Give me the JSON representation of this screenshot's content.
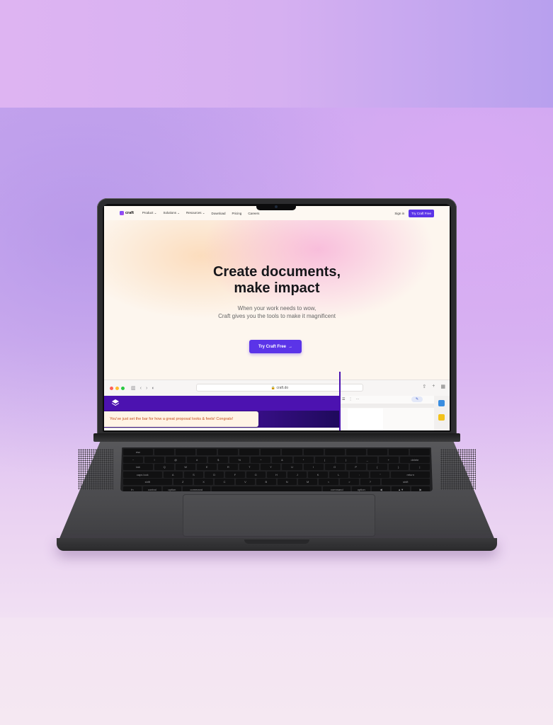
{
  "site": {
    "logo_text": "craft",
    "nav": [
      "Product ⌄",
      "Solutions ⌄",
      "Resources ⌄",
      "Download",
      "Pricing",
      "Careers"
    ],
    "sign_in": "Sign in",
    "nav_cta": "Try Craft Free",
    "hero_title_line1": "Create documents,",
    "hero_title_line2": "make impact",
    "hero_sub_line1": "When your work needs to wow,",
    "hero_sub_line2": "Craft gives you the tools to make it magnificent",
    "hero_cta": "Try Craft Free",
    "hero_cta_arrow": "→"
  },
  "browser": {
    "url": "craft.do",
    "toast": "You've just set the bar for how a great proposal looks & feels! Congrats!",
    "icons": [
      "sidebar-icon",
      "back-icon",
      "forward-icon",
      "shield-icon",
      "share-icon",
      "plus-icon",
      "tabs-icon"
    ]
  },
  "keyboard": {
    "row1": [
      "esc",
      "",
      "",
      "",
      "",
      "",
      "",
      "",
      "",
      "",
      "",
      "",
      "",
      ""
    ],
    "row2": [
      "~",
      "!",
      "@",
      "#",
      "$",
      "%",
      "^",
      "&",
      "*",
      "(",
      ")",
      "_",
      "+",
      "delete"
    ],
    "row3": [
      "tab",
      "Q",
      "W",
      "E",
      "R",
      "T",
      "Y",
      "U",
      "I",
      "O",
      "P",
      "{",
      "}",
      "|"
    ],
    "row4": [
      "caps lock",
      "A",
      "S",
      "D",
      "F",
      "G",
      "H",
      "J",
      "K",
      "L",
      ":",
      "\"",
      "return"
    ],
    "row5": [
      "shift",
      "Z",
      "X",
      "C",
      "V",
      "B",
      "N",
      "M",
      "<",
      ">",
      "?",
      "shift"
    ],
    "row6": [
      "fn",
      "control",
      "option",
      "command",
      "",
      "command",
      "option",
      "◀",
      "▲▼",
      "▶"
    ]
  },
  "colors": {
    "accent": "#5b34e8",
    "browser_purple": "#4c12b0",
    "toast_text": "#c44d1a"
  }
}
